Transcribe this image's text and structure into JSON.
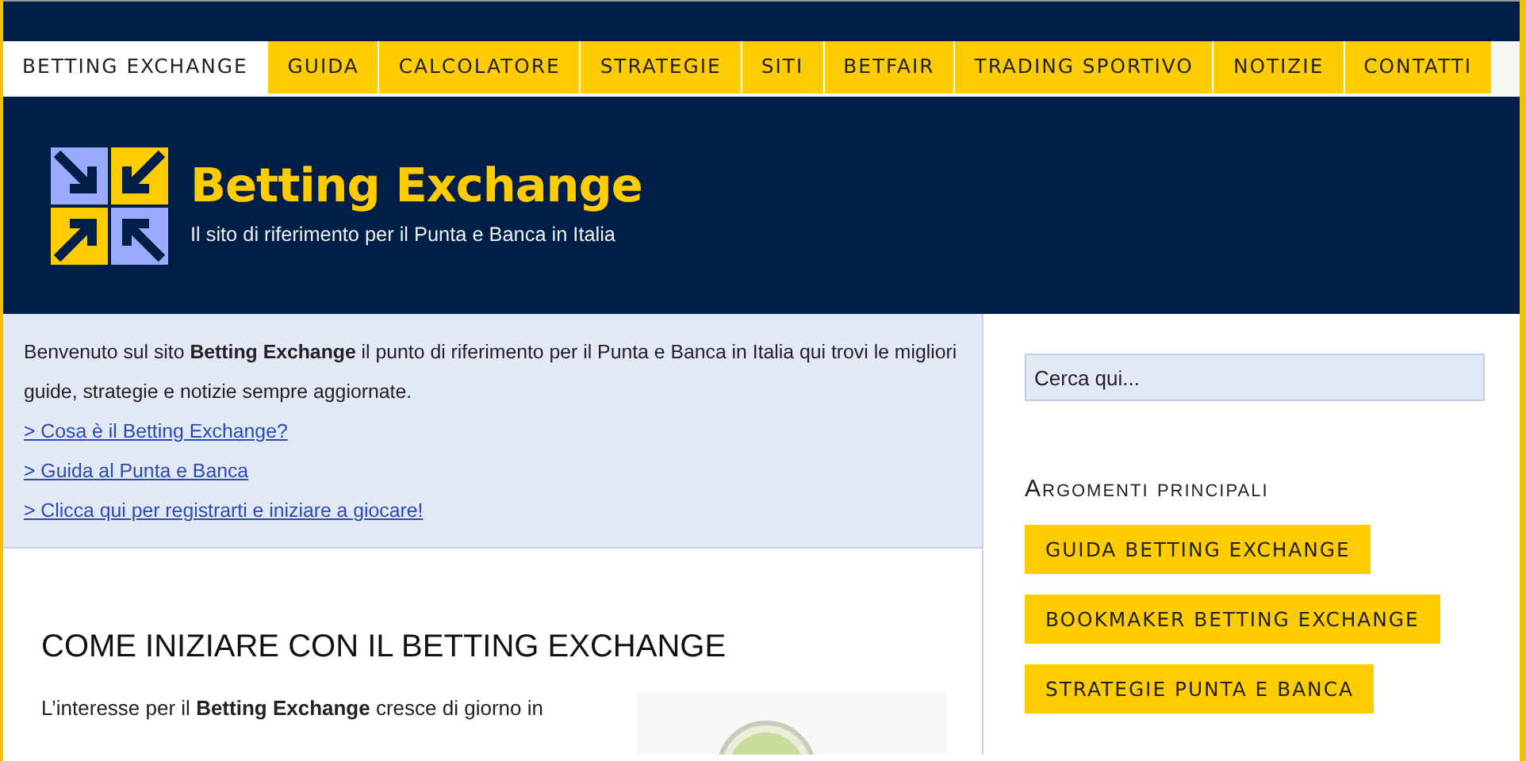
{
  "nav": [
    {
      "label": "BETTING EXCHANGE",
      "selected": true
    },
    {
      "label": "GUIDA",
      "selected": false
    },
    {
      "label": "CALCOLATORE",
      "selected": false
    },
    {
      "label": "STRATEGIE",
      "selected": false
    },
    {
      "label": "SITI",
      "selected": false
    },
    {
      "label": "BETFAIR",
      "selected": false
    },
    {
      "label": "TRADING SPORTIVO",
      "selected": false
    },
    {
      "label": "NOTIZIE",
      "selected": false
    },
    {
      "label": "CONTATTI",
      "selected": false
    }
  ],
  "header": {
    "title": "Betting Exchange",
    "tagline": "Il sito di riferimento per il Punta e Banca in Italia"
  },
  "welcome": {
    "text": "Benvenuto sul sito **Betting Exchange** il punto di riferimento per il Punta e Banca in Italia qui trovi le migliori guide, strategie e notizie sempre aggiornate.",
    "links": [
      "> Cosa è il Betting Exchange?",
      "> Guida al Punta e Banca",
      "> Clicca qui per registrarti e iniziare a giocare!"
    ]
  },
  "article": {
    "title": "COME INIZIARE CON IL BETTING EXCHANGE",
    "lines": [
      "L’interesse per il **Betting Exchange** cresce di giorno in"
    ]
  },
  "sidebar": {
    "search": {
      "placeholder": "Cerca qui..."
    },
    "heading": "Argomenti principali",
    "tags": [
      "GUIDA BETTING EXCHANGE",
      "BOOKMAKER BETTING EXCHANGE",
      "STRATEGIE PUNTA E BANCA"
    ]
  }
}
